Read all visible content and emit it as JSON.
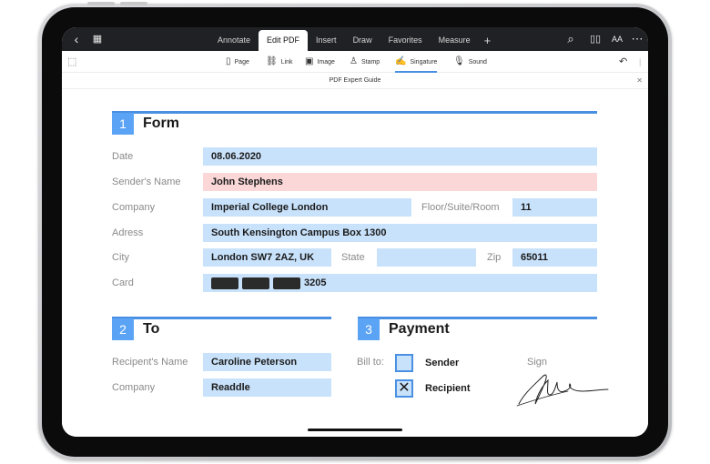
{
  "toolbar": {
    "tabs": [
      "Annotate",
      "Edit PDF",
      "Insert",
      "Draw",
      "Favorites",
      "Measure"
    ],
    "active_tab": "Edit PDF",
    "font_size_label": "AA"
  },
  "tools": {
    "page": "Page",
    "link": "Link",
    "image": "Image",
    "stamp": "Stamp",
    "signature": "Singature",
    "sound": "Sound"
  },
  "document_title": "PDF Expert Guide",
  "form": {
    "number": "1",
    "title": "Form",
    "date_label": "Date",
    "date": "08.06.2020",
    "sender_label": "Sender's Name",
    "sender": "John Stephens",
    "company_label": "Company",
    "company": "Imperial College London",
    "floor_label": "Floor/Suite/Room",
    "floor": "11",
    "address_label": "Adress",
    "address": "South Kensington Campus Box 1300",
    "city_label": "City",
    "city": "London SW7 2AZ, UK",
    "state_label": "State",
    "state": "",
    "zip_label": "Zip",
    "zip": "65011",
    "card_label": "Card",
    "card_last": "3205"
  },
  "to": {
    "number": "2",
    "title": "To",
    "recipient_label": "Recipent's Name",
    "recipient": "Caroline Peterson",
    "company_label": "Company",
    "company": "Readdle"
  },
  "payment": {
    "number": "3",
    "title": "Payment",
    "bill_to_label": "Bill to:",
    "sender_option": "Sender",
    "recipient_option": "Recipient",
    "sender_checked": false,
    "recipient_checked": true,
    "sign_label": "Sign"
  },
  "colors": {
    "accent": "#4a90e2",
    "field": "#c9e2fb",
    "field_highlight": "#fbd7d8",
    "toolbar": "#202124"
  }
}
